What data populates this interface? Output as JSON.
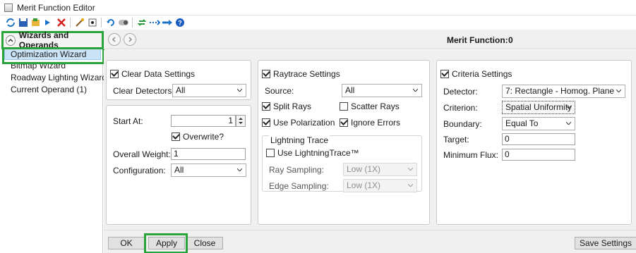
{
  "window": {
    "title": "Merit Function Editor"
  },
  "toolbar": {
    "icons": [
      "refresh-icon",
      "save-icon",
      "open-icon",
      "arrow-right-icon",
      "delete-icon",
      "wand-icon",
      "dot-icon",
      "undo-icon",
      "toggle-icon",
      "sync-icon",
      "insert-icon",
      "arrow-icon",
      "help-icon"
    ]
  },
  "left_panel": {
    "header": "Wizards and Operands",
    "items": [
      {
        "label": "Optimization Wizard",
        "selected": true
      },
      {
        "label": "Bitmap Wizard"
      },
      {
        "label": "Roadway Lighting Wizard"
      },
      {
        "label": "Current Operand (1)"
      }
    ]
  },
  "navbar": {
    "merit_label": "Merit Function:",
    "merit_value": "0"
  },
  "clear_data": {
    "title": "Clear Data Settings",
    "checked": true,
    "detectors_label": "Clear Detectors:",
    "detectors_value": "All"
  },
  "operands": {
    "start_at_label": "Start At:",
    "start_at_value": "1",
    "overwrite_label": "Overwrite?",
    "overwrite_checked": true,
    "weight_label": "Overall Weight:",
    "weight_value": "1",
    "config_label": "Configuration:",
    "config_value": "All"
  },
  "raytrace": {
    "title": "Raytrace Settings",
    "checked": true,
    "source_label": "Source:",
    "source_value": "All",
    "split_rays": "Split Rays",
    "split_rays_checked": true,
    "scatter_rays": "Scatter Rays",
    "scatter_rays_checked": false,
    "use_polarization": "Use Polarization",
    "use_polarization_checked": true,
    "ignore_errors": "Ignore Errors",
    "ignore_errors_checked": true,
    "lightning_group": "Lightning Trace",
    "use_lightning": "Use LightningTrace™",
    "use_lightning_checked": false,
    "ray_sampling_label": "Ray Sampling:",
    "ray_sampling_value": "Low (1X)",
    "edge_sampling_label": "Edge Sampling:",
    "edge_sampling_value": "Low (1X)"
  },
  "criteria": {
    "title": "Criteria Settings",
    "checked": true,
    "detector_label": "Detector:",
    "detector_value": "7: Rectangle - Homog. Plane",
    "criterion_label": "Criterion:",
    "criterion_value": "Spatial Uniformity",
    "boundary_label": "Boundary:",
    "boundary_value": "Equal To",
    "target_label": "Target:",
    "target_value": "0",
    "min_flux_label": "Minimum Flux:",
    "min_flux_value": "0"
  },
  "buttons": {
    "ok": "OK",
    "apply": "Apply",
    "close": "Close",
    "save_settings": "Save Settings"
  },
  "colors": {
    "highlight": "#2aa33a",
    "selection": "#cce4f7"
  }
}
